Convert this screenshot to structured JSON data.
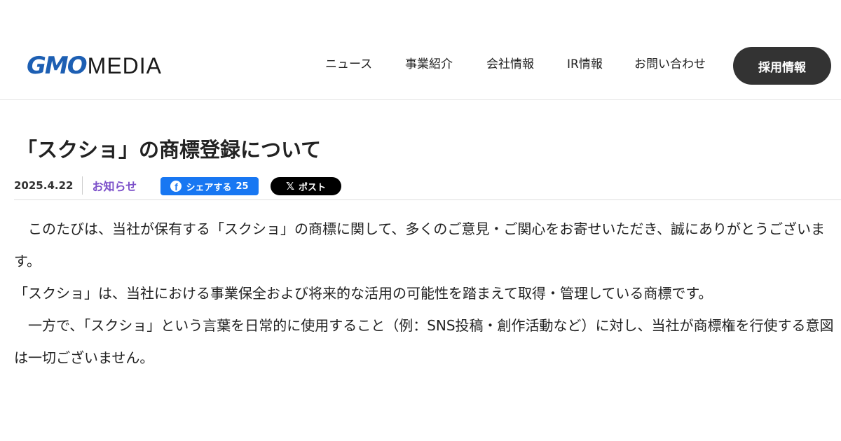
{
  "header": {
    "logo": {
      "brand": "GMO",
      "suffix": "MEDIA"
    },
    "nav": [
      {
        "label": "ニュース"
      },
      {
        "label": "事業紹介"
      },
      {
        "label": "会社情報"
      },
      {
        "label": "IR情報"
      },
      {
        "label": "お問い合わせ"
      }
    ],
    "cta_label": "採用情報"
  },
  "article": {
    "title": "「スクショ」の商標登録について",
    "date": "2025.4.22",
    "category": "お知らせ",
    "share": {
      "facebook_icon": "facebook-icon",
      "facebook_label": "シェアする",
      "facebook_count": "25",
      "x_icon": "x-icon",
      "x_label": "ポスト"
    },
    "paragraphs": [
      "　このたびは、当社が保有する「スクショ」の商標に関して、多くのご意見・ご関心をお寄せいただき、誠にありがとうございます。",
      "「スクショ」は、当社における事業保全および将来的な活用の可能性を踏まえて取得・管理している商標です。",
      "　一方で、「スクショ」という言葉を日常的に使用すること（例：SNS投稿・創作活動など）に対し、当社が商標権を行使する意図は一切ございません。"
    ]
  },
  "colors": {
    "brand_blue": "#1d5fb3",
    "category_purple": "#7b4fc9",
    "cta_background": "#333333",
    "facebook_blue": "#1877f2",
    "x_black": "#000000"
  }
}
